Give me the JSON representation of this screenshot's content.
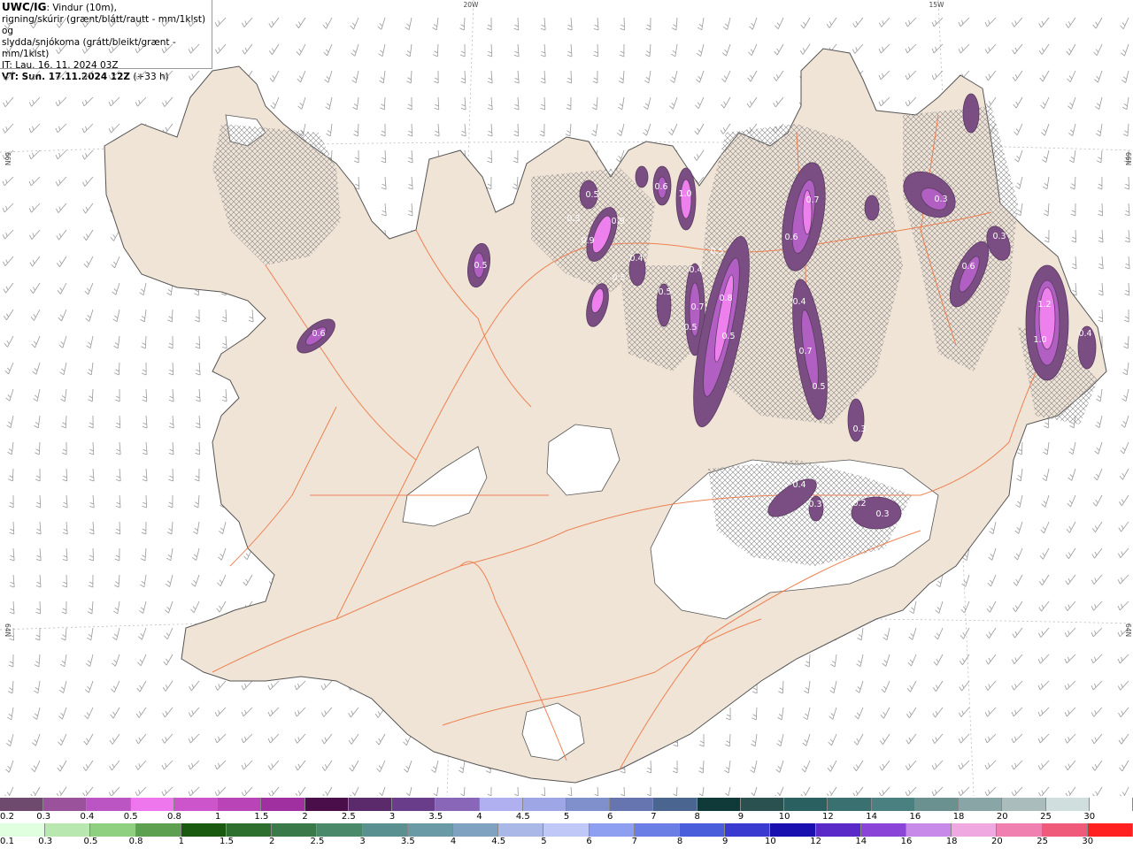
{
  "header": {
    "product": "UWC/IG",
    "line1_rest": ": Vindur (10m),",
    "line2": "rigning/skúrir (grænt/blátt/rautt - mm/1klst) og",
    "line3": "slydda/snjókoma (grátt/bleikt/grænt - mm/1klst)",
    "it_line": "IT: Lau. 16. 11. 2024 03Z",
    "vt_label": "VT: Sun. 17.11.2024 12Z",
    "vt_offset": " (+33 h)"
  },
  "grid_labels": {
    "top_20w": "20W",
    "top_15w": "15W",
    "left_66n": "66N",
    "right_66n": "66N",
    "left_64n": "64N",
    "right_64n": "64N"
  },
  "precip_labels": [
    "0.5",
    "0.6",
    "0.3",
    "0.9",
    "0.4",
    "0.9",
    "0.5",
    "0.6",
    "1.0",
    "0.5",
    "0.5",
    "0.4",
    "0.7",
    "0.8",
    "0.5",
    "0.5",
    "0.4",
    "0.7",
    "0.5",
    "0.3",
    "0.7",
    "0.6",
    "0.3",
    "1.2",
    "1.0",
    "0.4",
    "0.4",
    "0.3",
    "0.2",
    "0.3",
    "0.3",
    "0.6",
    "0.5"
  ],
  "snow_scale": {
    "labels": [
      "0.2",
      "0.3",
      "0.4",
      "0.5",
      "0.8",
      "1",
      "1.5",
      "2",
      "2.5",
      "3",
      "3.5",
      "4",
      "4.5",
      "5",
      "6",
      "7",
      "8",
      "9",
      "10",
      "12",
      "14",
      "16",
      "18",
      "20",
      "25",
      "30"
    ],
    "colors": [
      "#6e4a6e",
      "#9a529a",
      "#bb55c4",
      "#ee77ee",
      "#cc55cc",
      "#b844b8",
      "#a030a0",
      "#4a0f4a",
      "#5a2a6a",
      "#6a3d8a",
      "#8a66b8",
      "#b0b0f0",
      "#9fa6e6",
      "#8090cc",
      "#6675b0",
      "#4a6690",
      "#103a3a",
      "#2a5050",
      "#2a6060",
      "#3a7070",
      "#4a8080",
      "#6a9090",
      "#8aa5a5",
      "#aabcbc",
      "#d0dede",
      "#ffffff"
    ]
  },
  "rain_scale": {
    "labels": [
      "0.1",
      "0.3",
      "0.5",
      "0.8",
      "1",
      "1.5",
      "2",
      "2.5",
      "3",
      "3.5",
      "4",
      "4.5",
      "5",
      "6",
      "7",
      "8",
      "9",
      "10",
      "12",
      "14",
      "16",
      "18",
      "20",
      "25",
      "30"
    ],
    "colors": [
      "#dfffdf",
      "#b8e8b0",
      "#8fd080",
      "#5ca050",
      "#1a5a10",
      "#2e6e2e",
      "#3a7a4a",
      "#4a8a6a",
      "#5a9090",
      "#6a9aa6",
      "#7fa2c0",
      "#aab8e8",
      "#c0c8f8",
      "#8e9ef0",
      "#6a7ee6",
      "#4a5edc",
      "#3a3ad0",
      "#1a10b0",
      "#5a2ac8",
      "#8a44d8",
      "#c88ae8",
      "#f0a8e0",
      "#f080b0",
      "#f05a7a",
      "#ff2020"
    ]
  },
  "colors": {
    "land": "#f0e4d6",
    "sea": "#ffffff",
    "road": "#ee7744",
    "snow_light": "#7a4e82",
    "snow_mid": "#b25fc4",
    "snow_strong": "#ee80ee"
  }
}
